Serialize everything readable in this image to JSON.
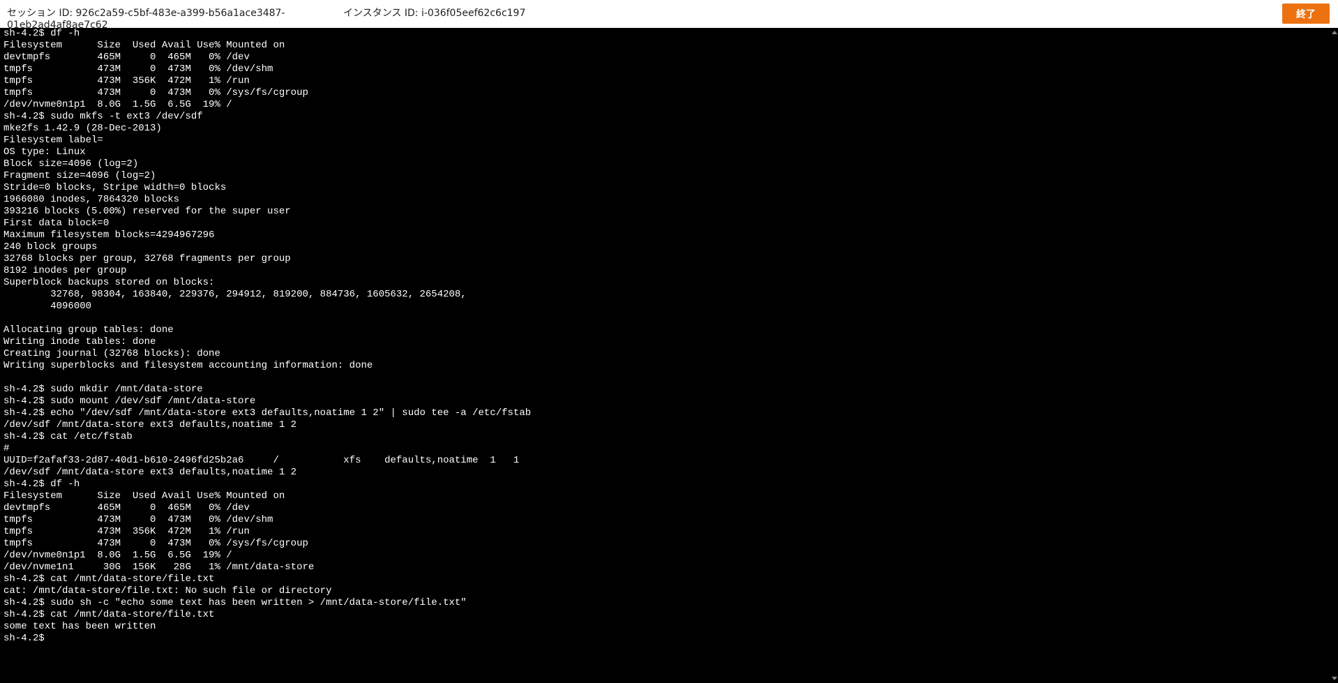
{
  "header": {
    "session_id": "セッション ID: 926c2a59-c5bf-483e-a399-b56a1ace3487-01eb2ad4af8ae7c62",
    "instance_id": "インスタンス ID: i-036f05eef62c6c197",
    "terminate_label": "終了"
  },
  "terminal": {
    "output": "sh-4.2$ df -h\nFilesystem      Size  Used Avail Use% Mounted on\ndevtmpfs        465M     0  465M   0% /dev\ntmpfs           473M     0  473M   0% /dev/shm\ntmpfs           473M  356K  472M   1% /run\ntmpfs           473M     0  473M   0% /sys/fs/cgroup\n/dev/nvme0n1p1  8.0G  1.5G  6.5G  19% /\nsh-4.2$ sudo mkfs -t ext3 /dev/sdf\nmke2fs 1.42.9 (28-Dec-2013)\nFilesystem label=\nOS type: Linux\nBlock size=4096 (log=2)\nFragment size=4096 (log=2)\nStride=0 blocks, Stripe width=0 blocks\n1966080 inodes, 7864320 blocks\n393216 blocks (5.00%) reserved for the super user\nFirst data block=0\nMaximum filesystem blocks=4294967296\n240 block groups\n32768 blocks per group, 32768 fragments per group\n8192 inodes per group\nSuperblock backups stored on blocks:\n        32768, 98304, 163840, 229376, 294912, 819200, 884736, 1605632, 2654208,\n        4096000\n\nAllocating group tables: done\nWriting inode tables: done\nCreating journal (32768 blocks): done\nWriting superblocks and filesystem accounting information: done\n\nsh-4.2$ sudo mkdir /mnt/data-store\nsh-4.2$ sudo mount /dev/sdf /mnt/data-store\nsh-4.2$ echo \"/dev/sdf /mnt/data-store ext3 defaults,noatime 1 2\" | sudo tee -a /etc/fstab\n/dev/sdf /mnt/data-store ext3 defaults,noatime 1 2\nsh-4.2$ cat /etc/fstab\n#\nUUID=f2afaf33-2d87-40d1-b610-2496fd25b2a6     /           xfs    defaults,noatime  1   1\n/dev/sdf /mnt/data-store ext3 defaults,noatime 1 2\nsh-4.2$ df -h\nFilesystem      Size  Used Avail Use% Mounted on\ndevtmpfs        465M     0  465M   0% /dev\ntmpfs           473M     0  473M   0% /dev/shm\ntmpfs           473M  356K  472M   1% /run\ntmpfs           473M     0  473M   0% /sys/fs/cgroup\n/dev/nvme0n1p1  8.0G  1.5G  6.5G  19% /\n/dev/nvme1n1     30G  156K   28G   1% /mnt/data-store\nsh-4.2$ cat /mnt/data-store/file.txt\ncat: /mnt/data-store/file.txt: No such file or directory\nsh-4.2$ sudo sh -c \"echo some text has been written > /mnt/data-store/file.txt\"\nsh-4.2$ cat /mnt/data-store/file.txt\nsome text has been written\nsh-4.2$"
  },
  "colors": {
    "terminate_button": "#ec7211",
    "terminal_background": "#000000",
    "terminal_text": "#ffffff"
  },
  "icons": {
    "scroll_up": "scroll-up-icon",
    "scroll_down": "scroll-down-icon"
  }
}
